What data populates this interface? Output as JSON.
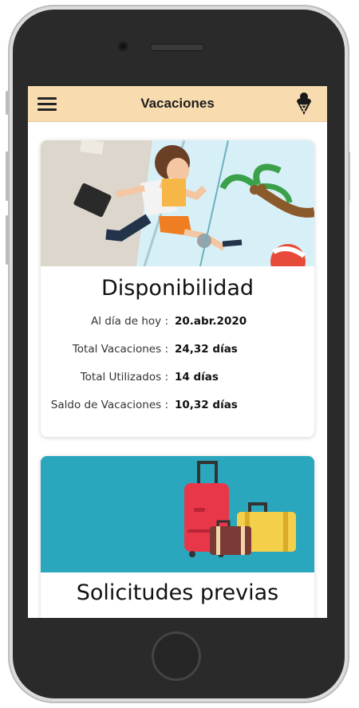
{
  "header": {
    "title": "Vacaciones",
    "menu_icon": "hamburger-menu-icon",
    "profile_icon": "ice-cream-icon"
  },
  "availability": {
    "title": "Disponibilidad",
    "rows": [
      {
        "label": "Al día de hoy :",
        "value": "20.abr.2020"
      },
      {
        "label": "Total Vacaciones :",
        "value": "24,32 días"
      },
      {
        "label": "Total Utilizados :",
        "value": "14 días"
      },
      {
        "label": "Saldo de Vacaciones :",
        "value": "10,32 días"
      }
    ]
  },
  "previous": {
    "title": "Solicitudes previas"
  },
  "colors": {
    "header_bg": "#f8dcb0",
    "banner2_bg": "#2aa6bd"
  }
}
